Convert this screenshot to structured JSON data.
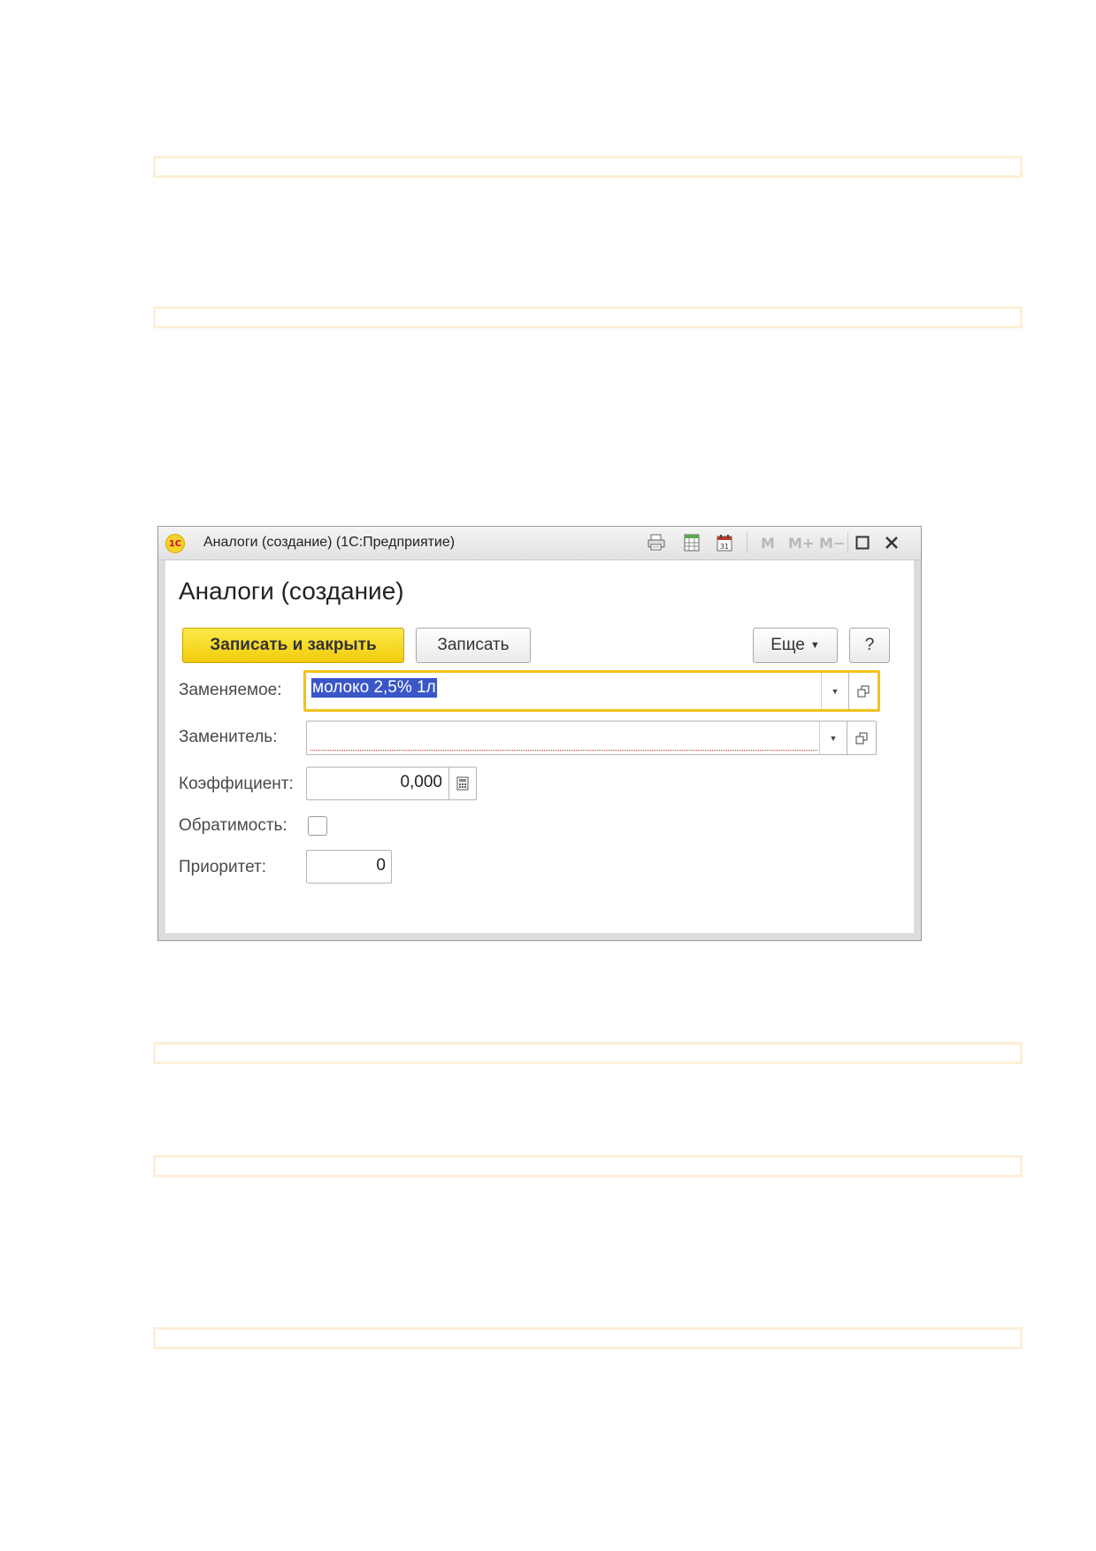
{
  "window": {
    "title": "Аналоги (создание)  (1С:Предприятие)",
    "logo_text": "1С",
    "memory_buttons": [
      "M",
      "M+",
      "M−"
    ]
  },
  "form": {
    "title": "Аналоги (создание)",
    "buttons": {
      "save_close": "Записать и закрыть",
      "save": "Записать",
      "more": "Еще",
      "help": "?"
    },
    "fields": {
      "replaceable": {
        "label": "Заменяемое:",
        "value": "молоко 2,5% 1л"
      },
      "replacement": {
        "label": "Заменитель:",
        "value": ""
      },
      "coefficient": {
        "label": "Коэффициент:",
        "value": "0,000"
      },
      "reversibility": {
        "label": "Обратимость:",
        "checked": false
      },
      "priority": {
        "label": "Приоритет:",
        "value": "0"
      }
    }
  },
  "colors": {
    "primary_button": "#f2cc0a",
    "focus_border": "#f2c21b",
    "selection": "#3a56c8",
    "required_mark": "#d0303a",
    "page_band_border": "#fdf0d8"
  }
}
